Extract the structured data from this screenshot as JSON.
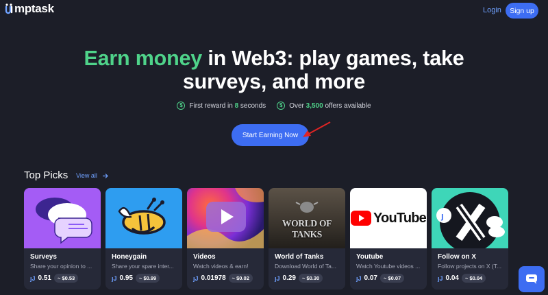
{
  "header": {
    "logo_text": "mptask",
    "login_label": "Login",
    "signup_label": "Sign up"
  },
  "hero": {
    "title_accent": "Earn money",
    "title_rest": " in Web3: play games, take surveys, and more",
    "feature1_pre": "First reward in ",
    "feature1_hl": "8",
    "feature1_post": " seconds",
    "feature2_pre": "Over ",
    "feature2_hl": "3,500",
    "feature2_post": " offers available",
    "cta_label": "Start Earning Now"
  },
  "top_picks": {
    "title": "Top Picks",
    "view_all_label": "View all",
    "cards": [
      {
        "title": "Surveys",
        "desc": "Share your opinion to ...",
        "reward": "0.51",
        "usd": "~ $0.53"
      },
      {
        "title": "Honeygain",
        "desc": "Share your spare inter...",
        "reward": "0.95",
        "usd": "~ $0.99"
      },
      {
        "title": "Videos",
        "desc": "Watch videos & earn!",
        "reward": "0.01978",
        "usd": "~ $0.02"
      },
      {
        "title": "World of Tanks",
        "desc": "Download World of Ta...",
        "reward": "0.29",
        "usd": "~ $0.30",
        "image_text": "WORLD OF TANKS"
      },
      {
        "title": "Youtube",
        "desc": "Watch Youtube videos ...",
        "reward": "0.07",
        "usd": "~ $0.07",
        "image_text": "YouTube"
      },
      {
        "title": "Follow on X",
        "desc": "Follow projects on X (T...",
        "reward": "0.04",
        "usd": "~ $0.04"
      }
    ]
  },
  "colors": {
    "background": "#1c1e28",
    "accent_green": "#4fd38a",
    "primary_blue": "#3d6df2",
    "card_bg": "#262938"
  },
  "icons": {
    "feature": "dollar-circle-icon",
    "view_all": "arrow-right-icon",
    "coin": "jumptask-coin-icon",
    "chat": "chat-icon"
  }
}
